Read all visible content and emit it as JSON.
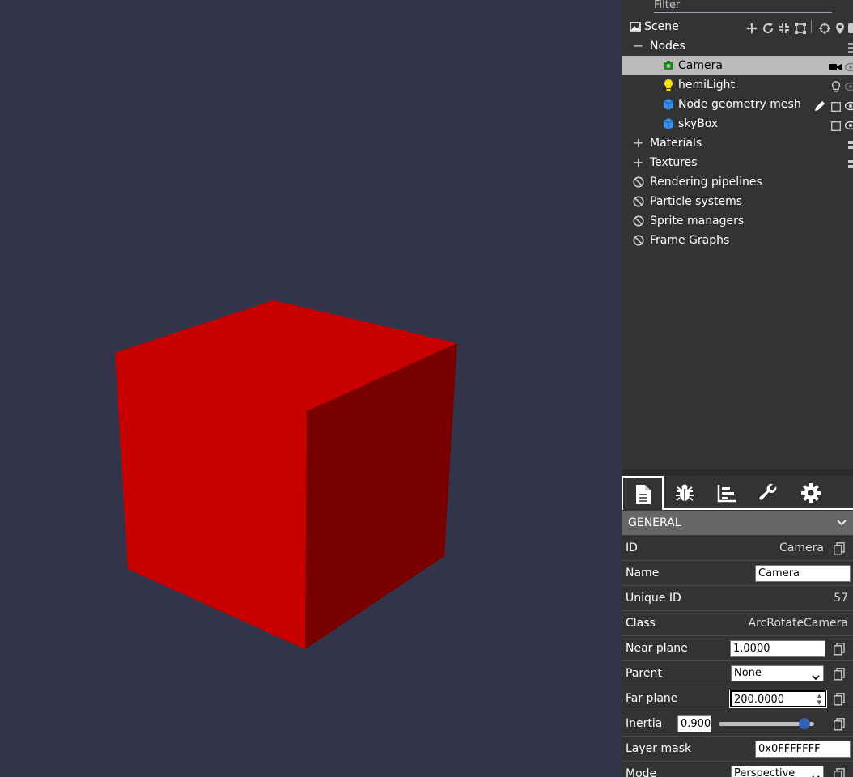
{
  "explorer": {
    "filter_placeholder": "Filter",
    "scene_label": "Scene",
    "nodes_label": "Nodes",
    "nodes": [
      {
        "label": "Camera",
        "icon": "camera-icon",
        "selected": true
      },
      {
        "label": "hemiLight",
        "icon": "lightbulb-icon"
      },
      {
        "label": "Node geometry mesh",
        "icon": "cube-icon"
      },
      {
        "label": "skyBox",
        "icon": "cube-icon"
      }
    ],
    "materials_label": "Materials",
    "textures_label": "Textures",
    "rendering_pipelines_label": "Rendering pipelines",
    "particle_systems_label": "Particle systems",
    "sprite_managers_label": "Sprite managers",
    "frame_graphs_label": "Frame Graphs"
  },
  "inspector": {
    "tabs": [
      "properties",
      "debug",
      "statistics",
      "tools",
      "settings"
    ],
    "section_title": "GENERAL",
    "id_label": "ID",
    "id_value": "Camera",
    "name_label": "Name",
    "name_value": "Camera",
    "unique_id_label": "Unique ID",
    "unique_id_value": "57",
    "class_label": "Class",
    "class_value": "ArcRotateCamera",
    "near_plane_label": "Near plane",
    "near_plane_value": "1.0000",
    "parent_label": "Parent",
    "parent_value": "None",
    "far_plane_label": "Far plane",
    "far_plane_value": "200.0000",
    "inertia_label": "Inertia",
    "inertia_value": "0.9000",
    "inertia_fraction": 0.9,
    "layer_mask_label": "Layer mask",
    "layer_mask_value": "0x0FFFFFFF",
    "mode_label": "Mode",
    "mode_value": "Perspective"
  },
  "colors": {
    "viewport_bg": "#333449",
    "cube_front": "#c90000",
    "cube_side": "#7a0000",
    "panel_bg": "#333333",
    "selected_row": "#bbbbbb"
  }
}
